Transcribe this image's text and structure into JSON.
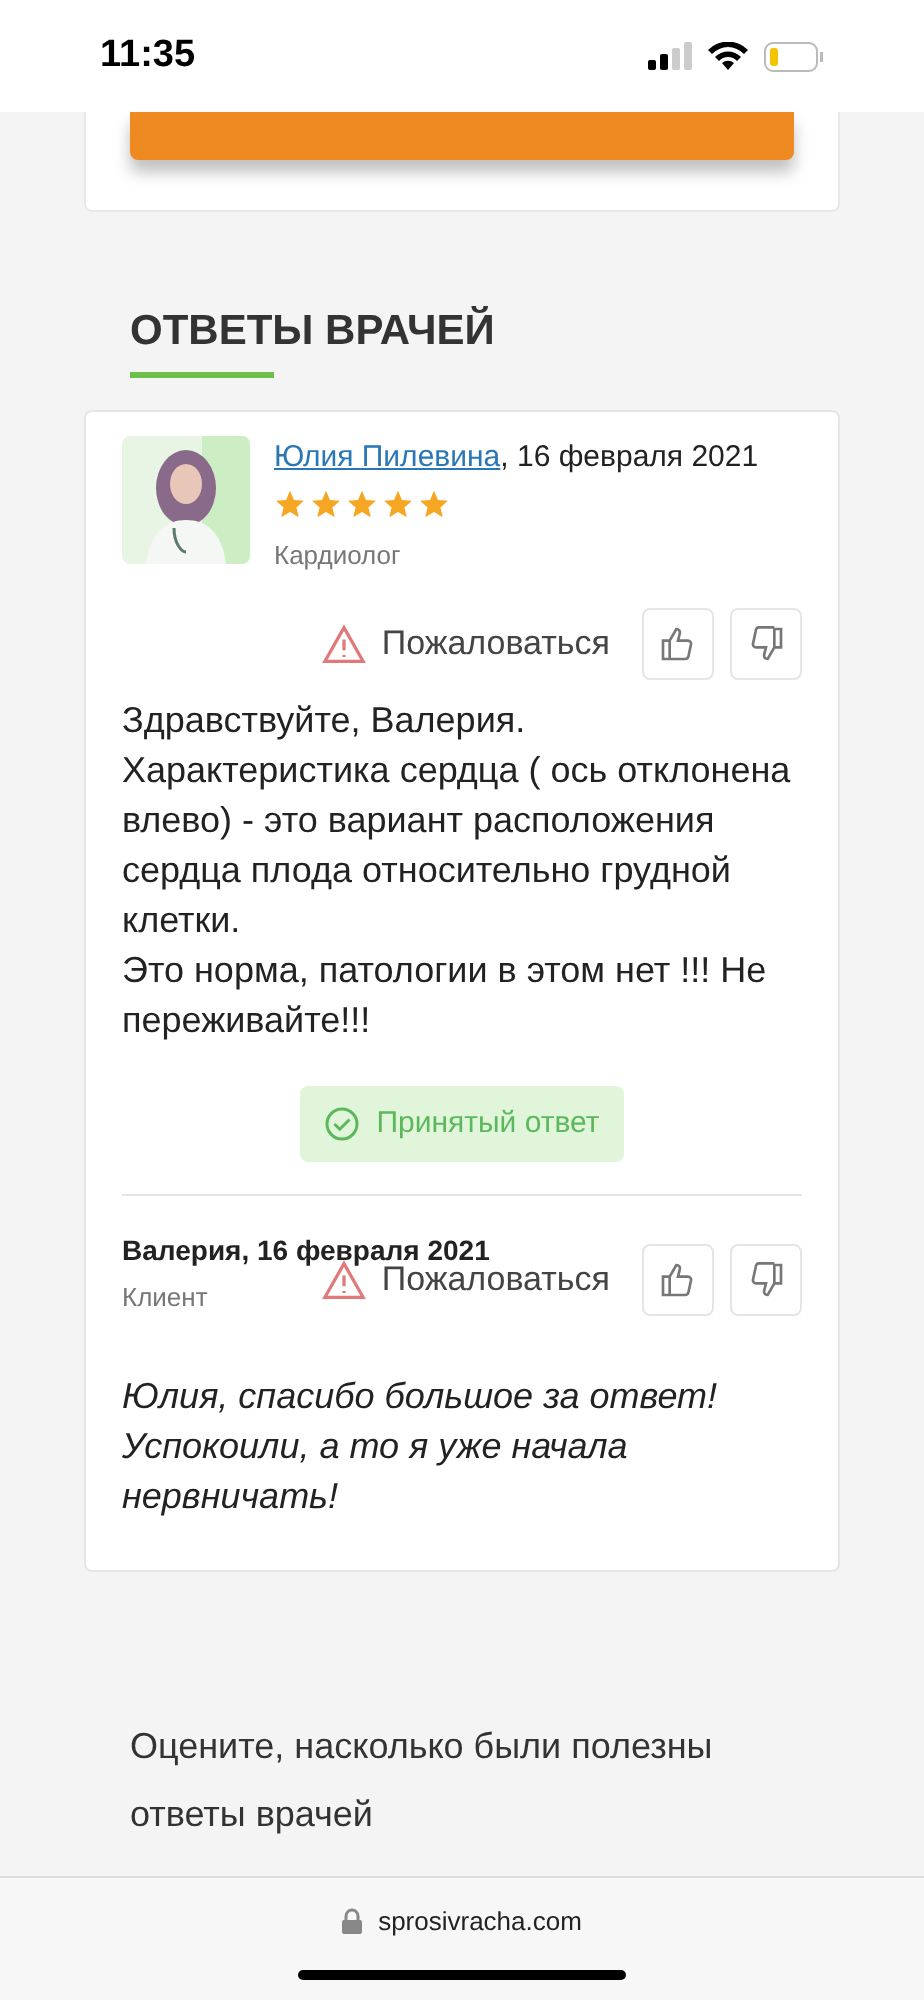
{
  "status_bar": {
    "time": "11:35"
  },
  "section_title": "ОТВЕТЫ ВРАЧЕЙ",
  "answers": [
    {
      "kind": "doctor",
      "author": "Юлия Пилевина",
      "date": ", 16 февраля 2021",
      "stars": 5,
      "role": "Кардиолог",
      "complaint": "Пожаловаться",
      "text": "Здравствуйте, Валерия.\nХарактеристика сердца ( ось отклонена влево) - это вариант расположения сердца плода относительно грудной клетки.\nЭто норма, патологии в этом нет !!! Не переживайте!!!",
      "accepted": true,
      "accepted_label": "Принятый ответ"
    },
    {
      "kind": "client",
      "author": "Валерия",
      "date": ", 16 февраля 2021",
      "role": "Клиент",
      "complaint": "Пожаловаться",
      "text": "Юлия, спасибо большое за ответ! Успокоили, а то я уже начала нервничать!"
    }
  ],
  "rate_prompt": "Оцените, насколько были полезны ответы врачей",
  "browser": {
    "url": "sprosivracha.com"
  }
}
